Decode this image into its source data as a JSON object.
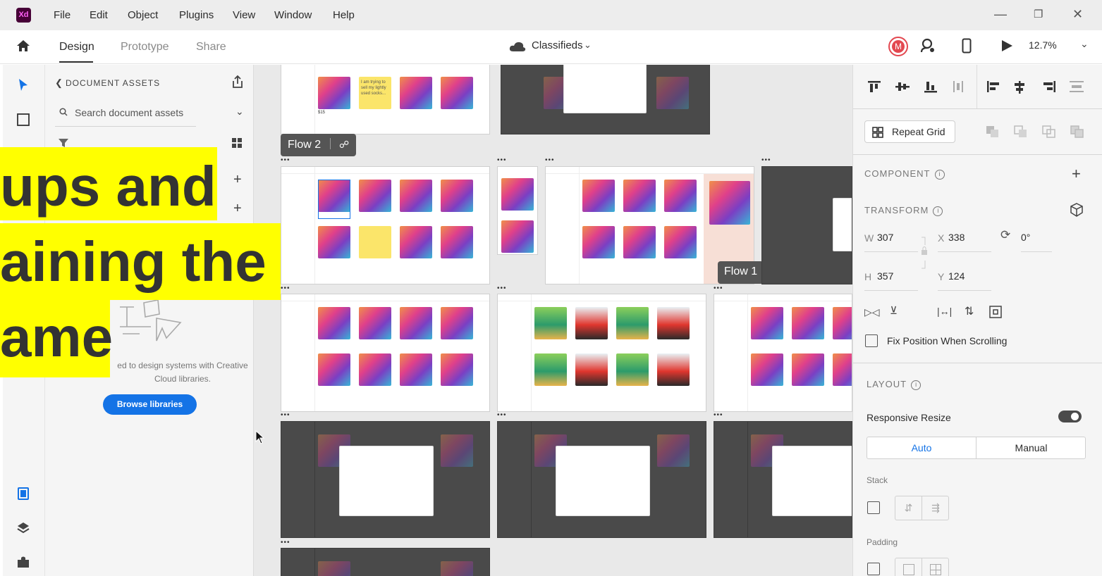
{
  "menubar": {
    "logo": "Xd",
    "items": [
      "File",
      "Edit",
      "Object",
      "Plugins",
      "View",
      "Window",
      "Help"
    ]
  },
  "tabs": {
    "design": "Design",
    "prototype": "Prototype",
    "share": "Share"
  },
  "document": {
    "title": "Classifieds",
    "zoom": "12.7%",
    "avatar_letter": "M"
  },
  "assets": {
    "header": "DOCUMENT ASSETS",
    "search_placeholder": "Search document assets",
    "description": "ed to design systems with Creative Cloud libraries.",
    "browse_button": "Browse libraries"
  },
  "canvas": {
    "flow2_label": "Flow 2",
    "flow1_label": "Flow 1",
    "note_text": "I am trying to sell my lightly used socks...",
    "price": "$15"
  },
  "properties": {
    "repeat_grid": "Repeat Grid",
    "component_title": "COMPONENT",
    "transform_title": "TRANSFORM",
    "w_label": "W",
    "w_value": "307",
    "x_label": "X",
    "x_value": "338",
    "h_label": "H",
    "h_value": "357",
    "y_label": "Y",
    "y_value": "124",
    "rotation": "0°",
    "fix_position": "Fix Position When Scrolling",
    "layout_title": "LAYOUT",
    "responsive_resize": "Responsive Resize",
    "auto": "Auto",
    "manual": "Manual",
    "stack": "Stack",
    "padding": "Padding"
  },
  "overlay": {
    "line1": "ups and",
    "line2": "aining the",
    "line3": "ame"
  },
  "colors": {
    "accent_blue": "#1473e6",
    "highlight": "#ffff00",
    "xd_brand": "#470137"
  }
}
